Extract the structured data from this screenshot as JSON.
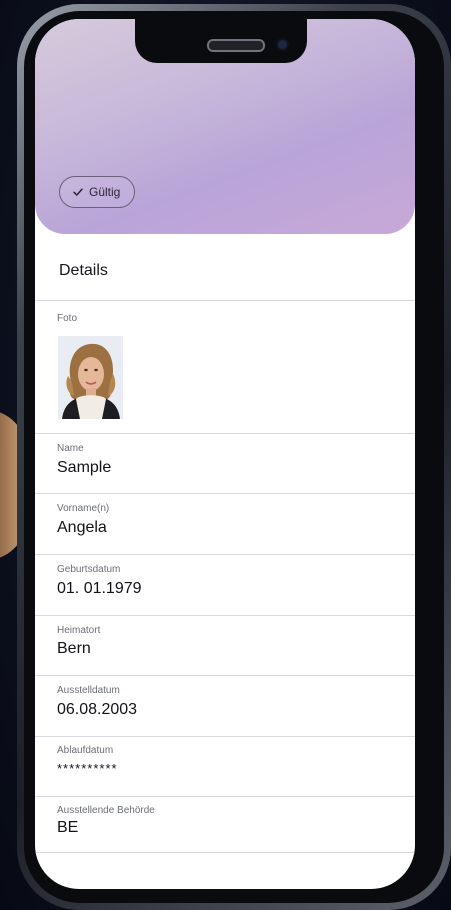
{
  "status": {
    "label": "Gültig",
    "icon": "check-icon"
  },
  "details": {
    "title": "Details",
    "photo_label": "Foto",
    "fields": [
      {
        "label": "Name",
        "value": "Sample"
      },
      {
        "label": "Vorname(n)",
        "value": "Angela"
      },
      {
        "label": "Geburtsdatum",
        "value": "01. 01.1979"
      },
      {
        "label": "Heimatort",
        "value": "Bern"
      },
      {
        "label": "Ausstelldatum",
        "value": "06.08.2003"
      },
      {
        "label": "Ablaufdatum",
        "value": "**********"
      },
      {
        "label": "Ausstellende Behörde",
        "value": "BE"
      }
    ]
  },
  "colors": {
    "hero_gradient": [
      "#d6cadb",
      "#b9a4d8"
    ],
    "text_primary": "#111318",
    "text_secondary": "#6b6e77",
    "divider": "#d9d9de"
  }
}
